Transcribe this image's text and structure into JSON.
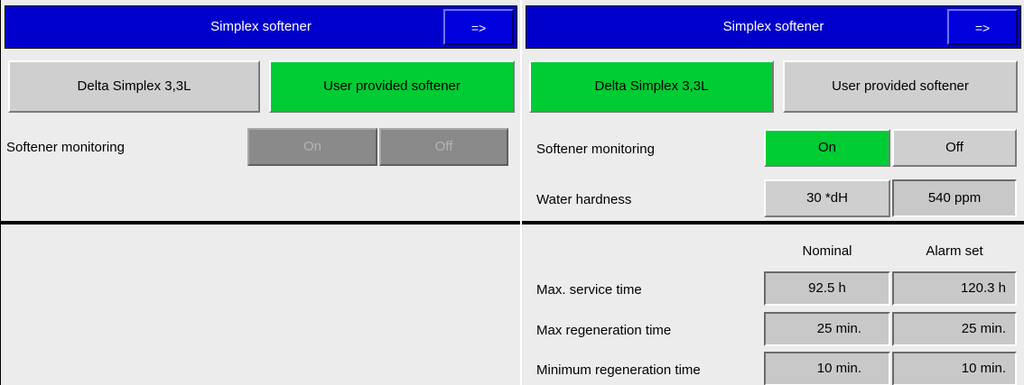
{
  "left": {
    "title": "Simplex softener",
    "arrow_label": "=>",
    "softener_options": [
      "Delta Simplex 3,3L",
      "User provided softener"
    ],
    "monitoring": {
      "label": "Softener monitoring",
      "on": "On",
      "off": "Off"
    }
  },
  "right": {
    "title": "Simplex softener",
    "arrow_label": "=>",
    "softener_options": [
      "Delta Simplex 3,3L",
      "User provided softener"
    ],
    "monitoring": {
      "label": "Softener monitoring",
      "on": "On",
      "off": "Off"
    },
    "hardness": {
      "label": "Water hardness",
      "dh": "30 *dH",
      "ppm": "540 ppm"
    },
    "table": {
      "headers": [
        "Nominal",
        "Alarm set"
      ],
      "rows": [
        {
          "label": "Max. service time",
          "nominal": "92.5 h",
          "alarm": "120.3 h"
        },
        {
          "label": "Max regeneration time",
          "nominal": "25 min.",
          "alarm": "25 min."
        },
        {
          "label": "Minimum regeneration time",
          "nominal": "10 min.",
          "alarm": "10 min."
        }
      ]
    }
  },
  "colors": {
    "title_bar": "#0000cc",
    "selected": "#00cc33",
    "unselected": "#cfcfcf",
    "disabled": "#8a8a8a"
  }
}
